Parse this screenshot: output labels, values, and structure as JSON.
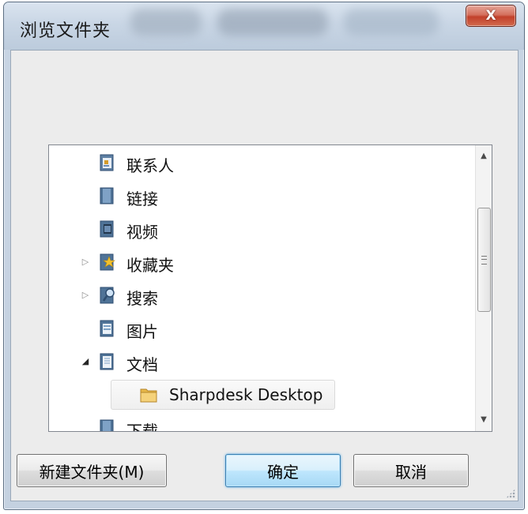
{
  "window": {
    "title": "浏览文件夹",
    "close_glyph": "X"
  },
  "description": "",
  "tree": {
    "items": [
      {
        "label": "联系人",
        "icon": "contacts-icon",
        "expander": "none"
      },
      {
        "label": "链接",
        "icon": "links-folder-icon",
        "expander": "none"
      },
      {
        "label": "视频",
        "icon": "videos-folder-icon",
        "expander": "none"
      },
      {
        "label": "收藏夹",
        "icon": "favorites-folder-icon",
        "expander": "collapsed"
      },
      {
        "label": "搜索",
        "icon": "searches-folder-icon",
        "expander": "collapsed"
      },
      {
        "label": "图片",
        "icon": "pictures-folder-icon",
        "expander": "none"
      },
      {
        "label": "文档",
        "icon": "documents-folder-icon",
        "expander": "expanded"
      },
      {
        "label": "Sharpdesk Desktop",
        "icon": "folder-icon",
        "expander": "none",
        "selected": true
      },
      {
        "label": "下载",
        "icon": "downloads-folder-icon",
        "expander": "none"
      }
    ],
    "scroll_position": 0.3
  },
  "buttons": {
    "new_folder": "新建文件夹(M)",
    "ok": "确定",
    "cancel": "取消"
  },
  "colors": {
    "frame": "#c4d1e0",
    "close_button": "#c2412b",
    "default_button_border": "#3c7fb1",
    "selection_border": "#dadada"
  }
}
